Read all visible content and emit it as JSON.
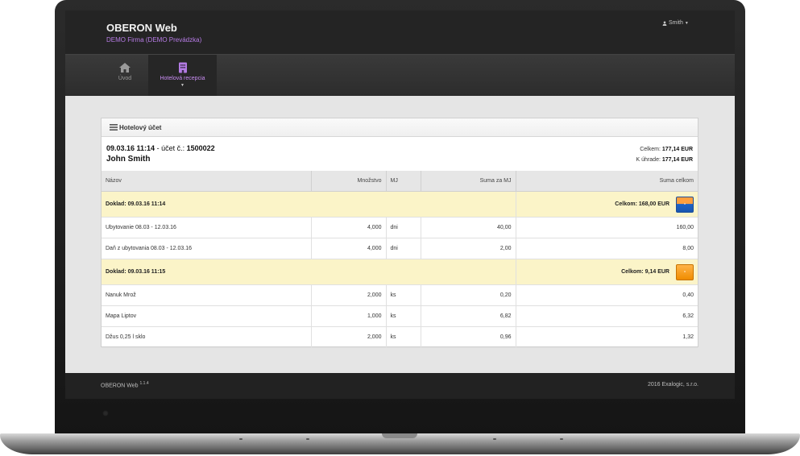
{
  "header": {
    "title": "OBERON Web",
    "subtitle": "DEMO Firma (DEMO Prevádzka)",
    "user": "Smith"
  },
  "nav": {
    "items": [
      {
        "label": "Úvod",
        "icon": "home-icon"
      },
      {
        "label": "Hotelová recepcia",
        "icon": "building-icon"
      }
    ]
  },
  "panel": {
    "title": "Hotelový účet",
    "account": {
      "datetime": "09.03.16 11:14",
      "account_label": "- účet č.:",
      "account_number": "1500022",
      "guest": "John Smith",
      "total_label": "Celkem:",
      "total_value": "177,14 EUR",
      "payment_label": "K úhrade:",
      "payment_value": "177,14 EUR"
    }
  },
  "table": {
    "columns": [
      "Názov",
      "Množstvo",
      "MJ",
      "Suma za MJ",
      "Suma celkom"
    ],
    "documents": [
      {
        "label": "Doklad: 09.03.16 11:14",
        "total": "Celkom: 168,00 EUR",
        "button_color": "#1d63c7",
        "button_label": "-",
        "items": [
          {
            "name": "Ubytovanie 08.03 - 12.03.16",
            "qty": "4,000",
            "unit": "dni",
            "unit_price": "40,00",
            "total": "160,00"
          },
          {
            "name": "Daň z ubytovania 08.03 - 12.03.16",
            "qty": "4,000",
            "unit": "dni",
            "unit_price": "2,00",
            "total": "8,00"
          }
        ]
      },
      {
        "label": "Doklad: 09.03.16 11:15",
        "total": "Celkom: 9,14 EUR",
        "button_color": "#f08c00",
        "button_label": "-",
        "items": [
          {
            "name": "Nanuk Mrož",
            "qty": "2,000",
            "unit": "ks",
            "unit_price": "0,20",
            "total": "0,40"
          },
          {
            "name": "Mapa Liptov",
            "qty": "1,000",
            "unit": "ks",
            "unit_price": "6,82",
            "total": "6,32"
          },
          {
            "name": "Džus 0,25 l sklo",
            "qty": "2,000",
            "unit": "ks",
            "unit_price": "0,96",
            "total": "1,32"
          }
        ]
      }
    ]
  },
  "footer": {
    "app": "OBERON Web",
    "version": "1.1.4",
    "year": "2016",
    "company": "Exalogic, s.r.o."
  }
}
